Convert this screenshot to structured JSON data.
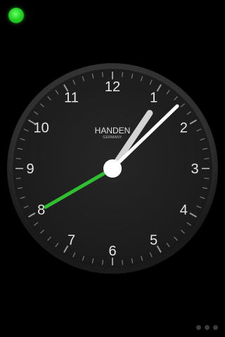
{
  "status": {
    "indicator_color": "#22d622"
  },
  "clock": {
    "brand": "HANDEN",
    "subbrand": "GERMANY",
    "numerals": [
      "12",
      "1",
      "2",
      "3",
      "4",
      "5",
      "6",
      "7",
      "8",
      "9",
      "10",
      "11"
    ],
    "time": {
      "hours": 1,
      "minutes": 7,
      "seconds": 40
    },
    "colors": {
      "face": "#1c1c1c",
      "bezel": "#3a3a3a",
      "hour_hand": "#d4d4d4",
      "minute_hand": "#ffffff",
      "second_hand": "#2fbf2f",
      "hub": "#ffffff"
    }
  },
  "pager": {
    "page_count": 3,
    "icon": "page-indicator-dots"
  }
}
